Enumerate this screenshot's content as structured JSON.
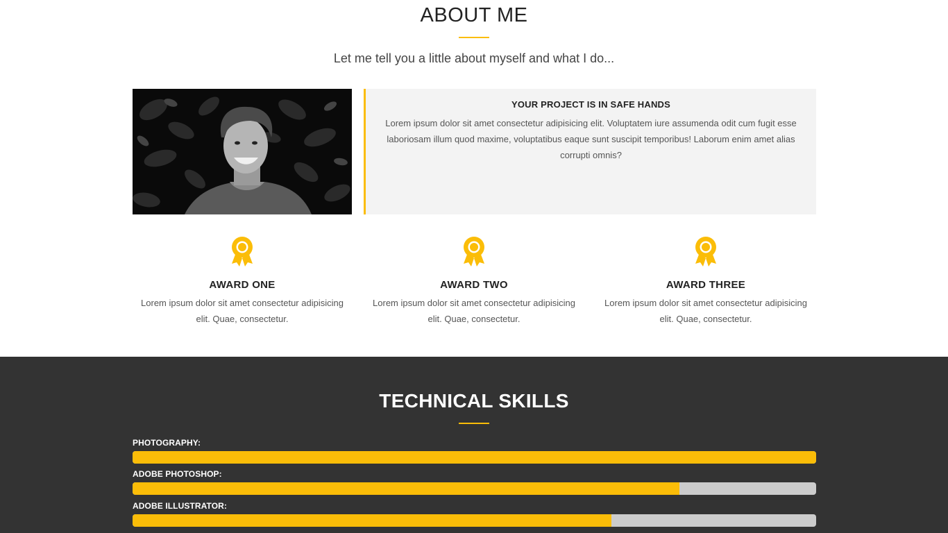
{
  "about": {
    "title": "ABOUT ME",
    "subtitle": "Let me tell you a little about myself and what I do...",
    "project": {
      "heading": "YOUR PROJECT IS IN SAFE HANDS",
      "text": "Lorem ipsum dolor sit amet consectetur adipisicing elit. Voluptatem iure assumenda odit cum fugit esse laboriosam illum quod maxime, voluptatibus eaque sunt suscipit temporibus! Laborum enim amet alias corrupti omnis?"
    },
    "awards": [
      {
        "title": "AWARD ONE",
        "text": "Lorem ipsum dolor sit amet consectetur adipisicing elit. Quae, consectetur."
      },
      {
        "title": "AWARD TWO",
        "text": "Lorem ipsum dolor sit amet consectetur adipisicing elit. Quae, consectetur."
      },
      {
        "title": "AWARD THREE",
        "text": "Lorem ipsum dolor sit amet consectetur adipisicing elit. Quae, consectetur."
      }
    ],
    "award_icon": "award-ribbon-icon"
  },
  "skills": {
    "title": "TECHNICAL SKILLS",
    "items": [
      {
        "label": "PHOTOGRAPHY:",
        "level": 1.0
      },
      {
        "label": "ADOBE PHOTOSHOP:",
        "level": 0.8
      },
      {
        "label": "ADOBE ILLUSTRATOR:",
        "level": 0.7
      }
    ]
  },
  "colors": {
    "accent": "#fbbd08",
    "dark_section": "#333333",
    "panel": "#f3f3f3",
    "track": "#cccccc"
  }
}
